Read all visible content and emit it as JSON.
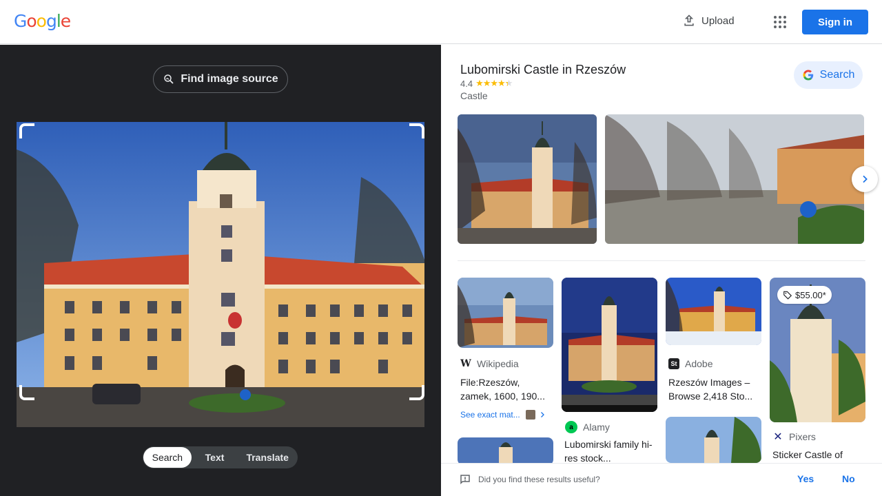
{
  "header": {
    "logo_letters": [
      {
        "ch": "G",
        "color": "#4285f4"
      },
      {
        "ch": "o",
        "color": "#ea4335"
      },
      {
        "ch": "o",
        "color": "#fbbc05"
      },
      {
        "ch": "g",
        "color": "#4285f4"
      },
      {
        "ch": "l",
        "color": "#34a853"
      },
      {
        "ch": "e",
        "color": "#ea4335"
      }
    ],
    "upload_label": "Upload",
    "apps_icon": "apps-grid-icon",
    "signin_label": "Sign in"
  },
  "lens": {
    "find_source_label": "Find image source",
    "modes": [
      "Search",
      "Text",
      "Translate"
    ],
    "active_mode": "Search"
  },
  "knowledge_panel": {
    "title": "Lubomirski Castle in Rzeszów",
    "rating": "4.4",
    "rating_stars": 4.4,
    "type": "Castle",
    "search_label": "Search"
  },
  "results": [
    {
      "source": "Wikipedia",
      "title": "File:Rzeszów, zamek, 1600, 190...",
      "exact_match": "See exact mat..."
    },
    {
      "source": "Alamy",
      "title": "Lubomirski family hi-res stock..."
    },
    {
      "source": "Adobe",
      "title": "Rzeszów Images – Browse 2,418 Sto..."
    },
    {
      "source": "Pixers",
      "title": "Sticker Castle of",
      "price": "$55.00*"
    }
  ],
  "feedback": {
    "question": "Did you find these results useful?",
    "yes": "Yes",
    "no": "No"
  },
  "colors": {
    "accent": "#1a73e8",
    "left_bg": "#202124"
  }
}
